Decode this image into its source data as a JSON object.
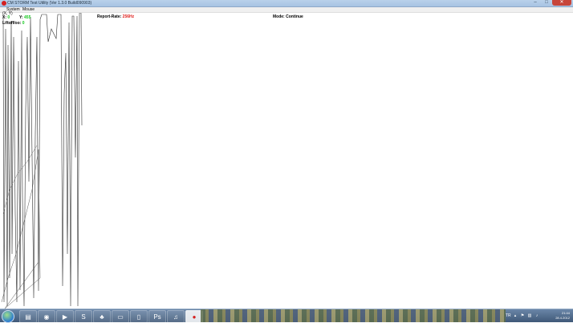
{
  "window": {
    "title": "CM STORM Test Utility  (Ver 1.3.0 Build090903)",
    "controls": {
      "minimize": "–",
      "maximize": "□",
      "close": "✕"
    }
  },
  "menu": {
    "items": [
      "System",
      "Mouse"
    ]
  },
  "readout": {
    "xy_label_top": "(X, Y)",
    "x_label": "X:",
    "x_value": "0",
    "y_label": "Y:",
    "y_value": "455",
    "lift_label": "Liftoff/oo:",
    "lift_value": "0",
    "report_rate_label": "Report-Rate:",
    "report_rate_value": "256Hz",
    "mode_label": "Mode:",
    "mode_value": "Continue"
  },
  "colors": {
    "value_green": "#14c81e",
    "value_red": "#e0201c",
    "close_red": "#c7453a"
  },
  "taskbar": {
    "apps": [
      "windows-start-icon",
      "explorer-icon",
      "chrome-icon",
      "media-icon",
      "skype-icon",
      "game-icon",
      "folder-icon",
      "file-icon",
      "photoshop-icon",
      "itunes-icon",
      "cmstorm-icon"
    ],
    "tray_lang": "TR",
    "clock_time": "21:44",
    "clock_date": "28.4.2012"
  }
}
